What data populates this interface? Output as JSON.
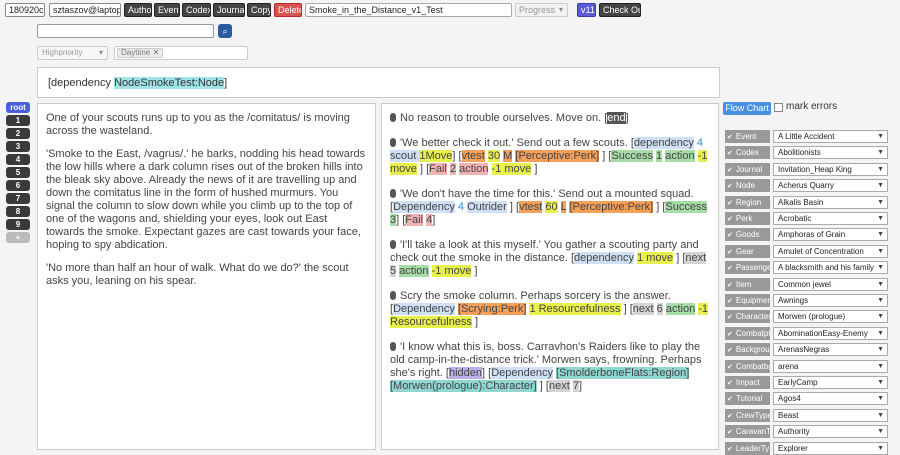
{
  "toolbar": {
    "id": "180920c",
    "user": "sztaszov@laptop",
    "author": "Author",
    "event": "Event",
    "codex": "Codex",
    "journal": "Journal",
    "copy": "Copy",
    "delete": "Delete",
    "title": "Smoke_in_the_Distance_v1_Test",
    "progress": "Progress",
    "version": "v11",
    "checkout": "Check Out"
  },
  "search": {
    "value": ""
  },
  "filters": {
    "priority": "Highpriority",
    "tag": "Daytime"
  },
  "dependency_line": {
    "open": "[dependency ",
    "node": "NodeSmokeTest:Node",
    "close": "]"
  },
  "nav": [
    "root",
    "1",
    "2",
    "3",
    "4",
    "5",
    "6",
    "7",
    "8",
    "9",
    "+"
  ],
  "narrative": {
    "p1": "One of your scouts runs up to you as the /comitatus/ is moving across the wasteland.",
    "p2": "'Smoke to the East, /vagrus/.' he barks, nodding his head towards the low hills where a dark column rises out of the broken hills into the bleak sky above. Already the news of it are travelling up and down the comitatus line in the form of hushed murmurs. You signal the column to slow down while you climb up to the top of one of the wagons and, shielding your eyes, look out East towards the smoke. Expectant gazes are cast towards your face, hoping to spy abdication.",
    "p3": "'No more than half an hour of walk. What do we do?' the scout asks you, leaning on his spear."
  },
  "options": {
    "o1": {
      "text": "No reason to trouble ourselves. Move on. [",
      "end": "end",
      "close": "]"
    },
    "o2": {
      "text": "'We better check it out.' Send out a few scouts. [",
      "dep": "dependency",
      "sp": " ",
      "scout_n": "4",
      "scout": " scout ",
      "move_n": "1",
      "move": "Move",
      "r1": "] [",
      "vtest": "vtest",
      "v_n": "30",
      "v_m": "M",
      "perk": "[Perceptive:Perk]",
      "r2": "] [",
      "success": "Success",
      "s_n": "1",
      "s_action": "action",
      "s_move": "-1 move",
      "r3": "] [",
      "fail": "Fail",
      "f_n": "2",
      "f_action": "action",
      "f_move": "-1 move",
      "close": "]"
    },
    "o3": {
      "text": "'We don't have the time for this.' Send out a mounted squad. [",
      "dep": "Dependency",
      "n": "4",
      "outrider": "Outrider",
      "r1": "] [",
      "vtest": "vtest",
      "v_n": "60",
      "v_l": "L",
      "perk": "[Perceptive:Perk]",
      "r2": "] [",
      "success": "Success",
      "s_n": "3",
      "r3": "] [",
      "fail": "Fail",
      "f_n": "4",
      "close": "]"
    },
    "o4": {
      "text": "'I'll take a look at this myself.' You gather a scouting party and check out the smoke in the distance. [",
      "dep": "dependency",
      "move": "1 move",
      "r1": "] [",
      "next": "next",
      "n": "5",
      "action": "action",
      "move2": "-1 move",
      "close": "]"
    },
    "o5": {
      "text": "Scry the smoke column. Perhaps sorcery is the answer. [",
      "dep": "Dependency",
      "perk": "[Scrying:Perk]",
      "res": "1 Resourcefulness",
      "r1": "] [",
      "next": "next",
      "n": "6",
      "action": "action",
      "res2": "-1 Resourcefulness",
      "close": "]"
    },
    "o6": {
      "text": "'I know what this is, boss. Carravhon's Raiders like to play the old camp-in-the-distance trick.' Morwen says, frowning. Perhaps she's right. [",
      "hidden": "hidden",
      "r1": "] [",
      "dep": "Dependency",
      "region": "[SmolderboneFlats:Region]",
      "char": "[Morwen(prologue):Character]",
      "r2": "] [",
      "next": "next",
      "n": "7",
      "close": "]"
    }
  },
  "flowchart": {
    "label": "Flow Chart",
    "mark_errors": "mark errors"
  },
  "fields": [
    {
      "label": "Event",
      "value": "A Little Accident"
    },
    {
      "label": "Codex",
      "value": "Abolitionists"
    },
    {
      "label": "Journal",
      "value": "Invitation_Heap King"
    },
    {
      "label": "Node",
      "value": "Acherus Quarry"
    },
    {
      "label": "Region",
      "value": "Alkalis Basin"
    },
    {
      "label": "Perk",
      "value": "Acrobatic"
    },
    {
      "label": "Goods",
      "value": "Amphoras of Grain"
    },
    {
      "label": "Gear",
      "value": "Amulet of Concentration"
    },
    {
      "label": "Passenger",
      "value": "A blacksmith and his family"
    },
    {
      "label": "Item",
      "value": "Common jewel"
    },
    {
      "label": "Equipment",
      "value": "Awnings"
    },
    {
      "label": "Character",
      "value": "Morwen (prologue)"
    },
    {
      "label": "Combatpl",
      "value": "AbominationEasy-Enemy"
    },
    {
      "label": "Background",
      "value": "ArenasNegras"
    },
    {
      "label": "Combatbg",
      "value": "arena"
    },
    {
      "label": "Impact",
      "value": "EarlyCamp"
    },
    {
      "label": "Tutorial",
      "value": "Agos4"
    },
    {
      "label": "CrewType",
      "value": "Beast"
    },
    {
      "label": "CaravanTy",
      "value": "Authority"
    },
    {
      "label": "LeaderTy",
      "value": "Explorer"
    }
  ],
  "colors": {
    "accent": "#4a8fe0",
    "version": "#5b5bd6",
    "delete": "#d9534f",
    "root": "#4a5fd9"
  }
}
